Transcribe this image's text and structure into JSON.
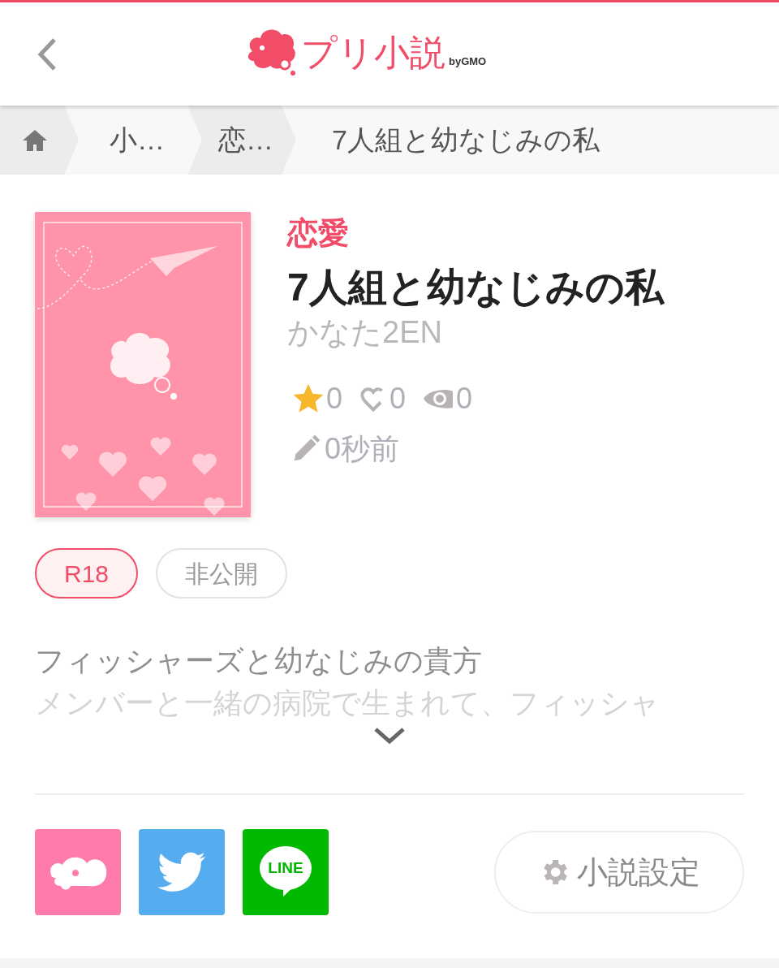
{
  "header": {
    "logo": {
      "title": "プリ小説",
      "byline": "byGMO"
    }
  },
  "breadcrumb": [
    {
      "kind": "home"
    },
    {
      "kind": "link",
      "label": "小…"
    },
    {
      "kind": "link",
      "label": "恋…"
    },
    {
      "kind": "current",
      "label": "7人組と幼なじみの私"
    }
  ],
  "novel": {
    "genre": "恋愛",
    "title": "7人組と幼なじみの私",
    "author": "かなた2EN",
    "stats": [
      {
        "kind": "star",
        "value": "0"
      },
      {
        "kind": "heart",
        "value": "0"
      },
      {
        "kind": "view",
        "value": "0"
      }
    ],
    "updated": "0秒前",
    "tags": [
      {
        "kind": "rating",
        "label": "R18"
      },
      {
        "kind": "status",
        "label": "非公開"
      }
    ],
    "description": [
      "フィッシャーズと幼なじみの貴方",
      "メンバーと一緒の病院で生まれて、フィッシャ"
    ]
  },
  "share": [
    {
      "kind": "prism"
    },
    {
      "kind": "twitter"
    },
    {
      "kind": "line",
      "label": "LINE"
    }
  ],
  "settings_button": "小説設定"
}
